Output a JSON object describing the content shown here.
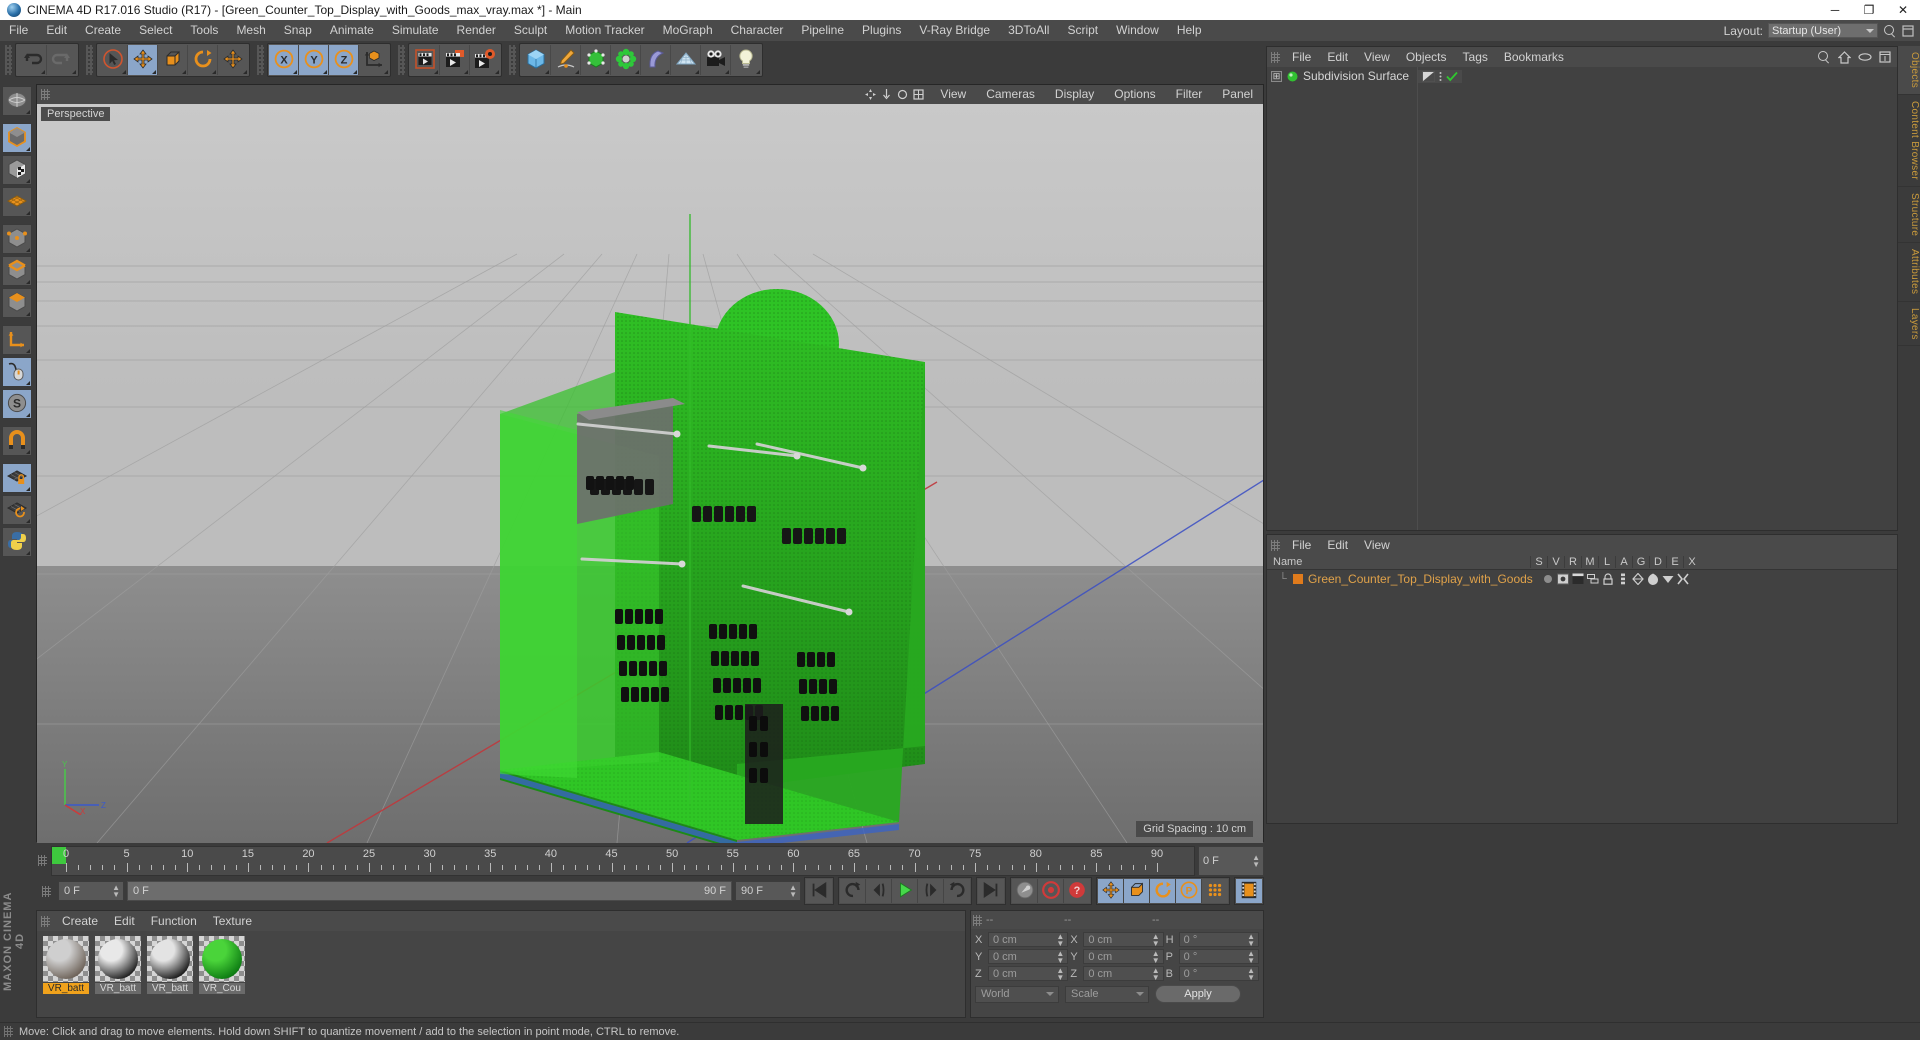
{
  "window": {
    "title": "CINEMA 4D R17.016 Studio (R17) - [Green_Counter_Top_Display_with_Goods_max_vray.max *] - Main",
    "minimize": "─",
    "maximize": "❐",
    "close": "✕"
  },
  "menubar": {
    "items": [
      "File",
      "Edit",
      "Create",
      "Select",
      "Tools",
      "Mesh",
      "Snap",
      "Animate",
      "Simulate",
      "Render",
      "Sculpt",
      "Motion Tracker",
      "MoGraph",
      "Character",
      "Pipeline",
      "Plugins",
      "V-Ray Bridge",
      "3DToAll",
      "Script",
      "Window",
      "Help"
    ],
    "layout_label": "Layout:",
    "layout_value": "Startup (User)"
  },
  "toolbar": {
    "groups": [
      {
        "name": "history",
        "buttons": [
          {
            "icon": "undo-icon",
            "active": false
          },
          {
            "icon": "redo-icon",
            "active": false
          }
        ]
      },
      {
        "name": "tools",
        "buttons": [
          {
            "icon": "select-cursor-icon",
            "active": false
          },
          {
            "icon": "move-tool-icon",
            "active": true
          },
          {
            "icon": "scale-tool-icon",
            "active": false
          },
          {
            "icon": "rotate-tool-icon",
            "active": false
          },
          {
            "icon": "move-axis-icon",
            "active": false
          }
        ]
      },
      {
        "name": "axis-locks",
        "buttons": [
          {
            "icon": "x-axis-icon",
            "active": true
          },
          {
            "icon": "y-axis-icon",
            "active": true
          },
          {
            "icon": "z-axis-icon",
            "active": true
          },
          {
            "icon": "world-object-axis-icon",
            "active": false
          }
        ]
      },
      {
        "name": "render",
        "buttons": [
          {
            "icon": "render-view-icon",
            "active": false
          },
          {
            "icon": "render-to-picture-viewer-icon",
            "active": false
          },
          {
            "icon": "render-settings-icon",
            "active": false
          }
        ]
      },
      {
        "name": "objects",
        "buttons": [
          {
            "icon": "cube-primitive-icon",
            "active": false
          },
          {
            "icon": "spline-pen-icon",
            "active": false
          },
          {
            "icon": "generator-nurbs-icon",
            "active": false
          },
          {
            "icon": "mograph-cloner-icon",
            "active": false
          },
          {
            "icon": "deformer-bend-icon",
            "active": false
          },
          {
            "icon": "environment-floor-icon",
            "active": false
          },
          {
            "icon": "camera-icon",
            "active": false
          },
          {
            "icon": "light-icon",
            "active": false
          }
        ]
      }
    ]
  },
  "leftbar": {
    "buttons": [
      {
        "icon": "live-selection-icon",
        "active": false,
        "gap": true
      },
      {
        "icon": "model-mode-icon",
        "active": true
      },
      {
        "icon": "texture-mode-icon",
        "active": false
      },
      {
        "icon": "workplane-mode-icon",
        "active": false,
        "gap": true
      },
      {
        "icon": "points-mode-icon",
        "active": false
      },
      {
        "icon": "edges-mode-icon",
        "active": false
      },
      {
        "icon": "polygons-mode-icon",
        "active": false,
        "gap": true
      },
      {
        "icon": "object-axis-mode-icon",
        "active": false
      },
      {
        "icon": "enable-axis-modification-icon",
        "active": true
      },
      {
        "icon": "scale-snap-s-icon",
        "active": true,
        "gap": true
      },
      {
        "icon": "magnet-icon",
        "active": false,
        "gap": true
      },
      {
        "icon": "lock-workplane-icon",
        "active": true
      },
      {
        "icon": "planar-workplane-icon",
        "active": false
      },
      {
        "icon": "python-script-icon",
        "active": false
      }
    ],
    "brand": "MAXON CINEMA 4D"
  },
  "viewport": {
    "menu": [
      "View",
      "Cameras",
      "Display",
      "Options",
      "Filter",
      "Panel"
    ],
    "label": "Perspective",
    "grid_spacing": "Grid Spacing : 10 cm",
    "axis_labels": {
      "x": "X",
      "y": "Y",
      "z": "Z"
    },
    "scene_note": "Green counter-top display with goods (3D model)"
  },
  "object_manager": {
    "menu": [
      "File",
      "Edit",
      "View",
      "Objects",
      "Tags",
      "Bookmarks"
    ],
    "icons": [
      "search-icon",
      "home-icon",
      "eye-icon",
      "fit-icon"
    ],
    "row": {
      "name": "Subdivision Surface",
      "expand": "⊞",
      "tags": [
        "display-tag-icon",
        "dots-icon",
        "check-icon"
      ]
    }
  },
  "object_list": {
    "menu": [
      "File",
      "Edit",
      "View"
    ],
    "columns": [
      "Name",
      "S",
      "V",
      "R",
      "M",
      "L",
      "A",
      "G",
      "D",
      "E",
      "X"
    ],
    "rows": [
      {
        "tree": "└",
        "name": "Green_Counter_Top_Display_with_Goods",
        "tags": [
          "dot-icon",
          "visibility-icon",
          "render-icon",
          "layer-icon",
          "lock-icon",
          "anim-icon",
          "generator-icon",
          "deformer-icon",
          "display-icon",
          "xpresso-icon"
        ]
      }
    ]
  },
  "right_tabs": [
    {
      "label": "Objects",
      "on": true
    },
    {
      "label": "Content Browser",
      "on": false
    },
    {
      "label": "Structure",
      "on": false
    },
    {
      "label": "Attributes",
      "on": false
    },
    {
      "label": "Layers",
      "on": false
    }
  ],
  "timeline": {
    "ticks": [
      0,
      5,
      10,
      15,
      20,
      25,
      30,
      35,
      40,
      45,
      50,
      55,
      60,
      65,
      70,
      75,
      80,
      85,
      90
    ],
    "current_frame": "0 F",
    "min_field": "0 F",
    "range_start": "0 F",
    "range_end": "90 F",
    "max_field": "90 F"
  },
  "transport": {
    "buttons": [
      {
        "icon": "go-to-start-icon",
        "active": false
      },
      {
        "icon": "previous-key-icon",
        "active": false
      },
      {
        "icon": "step-back-icon",
        "active": false
      },
      {
        "icon": "play-icon",
        "active": false
      },
      {
        "icon": "step-forward-icon",
        "active": false
      },
      {
        "icon": "next-key-icon",
        "active": false
      },
      {
        "icon": "go-to-end-icon",
        "active": false
      },
      {
        "icon": "record-autokey-icon",
        "active": false
      },
      {
        "icon": "record-active-objects-icon",
        "active": false
      },
      {
        "icon": "autokeying-icon",
        "active": false
      },
      {
        "icon": "key-position-icon",
        "active": true
      },
      {
        "icon": "key-scale-icon",
        "active": true
      },
      {
        "icon": "key-rotation-icon",
        "active": true
      },
      {
        "icon": "key-parameter-icon",
        "active": true
      },
      {
        "icon": "key-point-level-icon",
        "active": false
      },
      {
        "icon": "timeline-icon",
        "active": true
      }
    ]
  },
  "material_manager": {
    "menu": [
      "Create",
      "Edit",
      "Function",
      "Texture"
    ],
    "materials": [
      {
        "name": "VR_batt",
        "color1": "#cfcfcf",
        "color2": "#6d6258",
        "selected": true
      },
      {
        "name": "VR_batt",
        "color1": "#e8e8e8",
        "color2": "#202020",
        "selected": false
      },
      {
        "name": "VR_batt",
        "color1": "#e3e3e3",
        "color2": "#1c1c1c",
        "selected": false
      },
      {
        "name": "VR_Cou",
        "color1": "#4ad43a",
        "color2": "#0c7a12",
        "selected": false
      }
    ]
  },
  "coordinate_manager": {
    "headers": [
      "--",
      "--",
      "--"
    ],
    "position": {
      "label_x": "X",
      "label_y": "Y",
      "label_z": "Z",
      "x": "0 cm",
      "y": "0 cm",
      "z": "0 cm"
    },
    "size": {
      "label_x": "X",
      "label_y": "Y",
      "label_z": "Z",
      "x": "0 cm",
      "y": "0 cm",
      "z": "0 cm"
    },
    "rotation": {
      "label_h": "H",
      "label_p": "P",
      "label_b": "B",
      "h": "0 °",
      "p": "0 °",
      "b": "0 °"
    },
    "coord_system": "World",
    "transform_mode": "Scale",
    "apply_label": "Apply"
  },
  "statusbar": {
    "message": "Move: Click and drag to move elements. Hold down SHIFT to quantize movement / add to the selection in point mode, CTRL to remove."
  },
  "colors": {
    "accent_orange": "#e8901c",
    "accent_blue": "#8ba6c9",
    "bg": "#3b3b3b",
    "panel": "#454545",
    "green_model": "#2fbf24"
  }
}
